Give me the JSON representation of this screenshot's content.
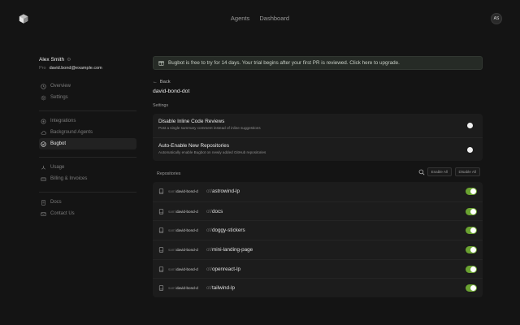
{
  "header": {
    "nav": [
      "Agents",
      "Dashboard"
    ],
    "avatar_initials": "AS",
    "logo_icon": "cube-icon"
  },
  "sidebar": {
    "user_name": "Alex Smith",
    "plan": "Pro",
    "email": "david.bond@example.com",
    "groups": [
      [
        {
          "label": "Overview",
          "icon": "clock-icon"
        },
        {
          "label": "Settings",
          "icon": "gear-icon"
        }
      ],
      [
        {
          "label": "Integrations",
          "icon": "puzzle-icon"
        },
        {
          "label": "Background Agents",
          "icon": "cloud-icon"
        },
        {
          "label": "Bugbot",
          "icon": "check-circle-icon",
          "active": true
        }
      ],
      [
        {
          "label": "Usage",
          "icon": "chart-icon"
        },
        {
          "label": "Billing & Invoices",
          "icon": "card-icon"
        }
      ],
      [
        {
          "label": "Docs",
          "icon": "doc-icon"
        },
        {
          "label": "Contact Us",
          "icon": "mail-icon"
        }
      ]
    ]
  },
  "main": {
    "banner": "Bugbot is free to try for 14 days. Your trial begins after your first PR is reviewed. Click here to upgrade.",
    "back_label": "Back",
    "repo_title": "david-bond-dot",
    "settings_label": "Settings",
    "settings": [
      {
        "title": "Disable Inline Code Reviews",
        "desc": "Post a single summary comment instead of inline suggestions"
      },
      {
        "title": "Auto-Enable New Repositories",
        "desc": "Automatically enable Bugbot on newly added GitHub repositories"
      }
    ],
    "repos_label": "Repositories",
    "enable_all": "Enable All",
    "disable_all": "Disable All",
    "repos": [
      {
        "owner_prefix": "sam/",
        "owner": "david-bond-d",
        "name_prefix": "ot/",
        "name": "astrowind-lp",
        "enabled": true
      },
      {
        "owner_prefix": "sam/",
        "owner": "david-bond-d",
        "name_prefix": "ot/",
        "name": "docs",
        "enabled": true
      },
      {
        "owner_prefix": "sam/",
        "owner": "david-bond-d",
        "name_prefix": "ot/",
        "name": "doggy-stickers",
        "enabled": true
      },
      {
        "owner_prefix": "sam/",
        "owner": "david-bond-d",
        "name_prefix": "ot/",
        "name": "mini-landing-page",
        "enabled": true
      },
      {
        "owner_prefix": "sam/",
        "owner": "david-bond-d",
        "name_prefix": "ot/",
        "name": "openreact-lp",
        "enabled": true
      },
      {
        "owner_prefix": "sam/",
        "owner": "david-bond-d",
        "name_prefix": "ot/",
        "name": "tailwind-lp",
        "enabled": true
      }
    ]
  },
  "colors": {
    "accent_toggle": "#6ba331",
    "background": "#141414",
    "banner_bg": "#262b26"
  }
}
